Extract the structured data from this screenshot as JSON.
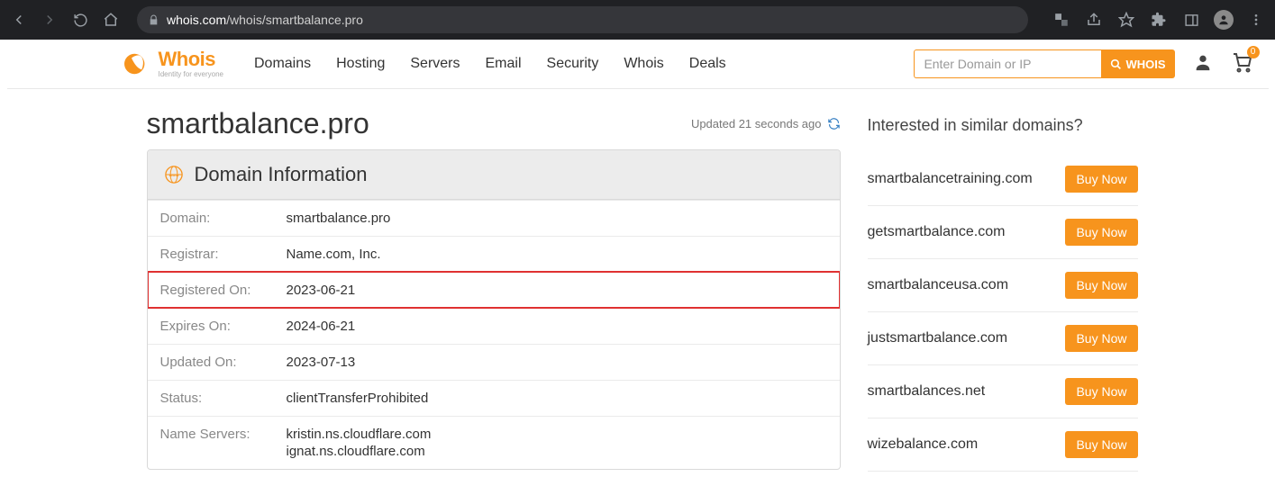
{
  "browser": {
    "url_host": "whois.com",
    "url_path": "/whois/smartbalance.pro"
  },
  "logo": {
    "word": "Whois",
    "tagline": "Identity for everyone"
  },
  "nav": {
    "items": [
      "Domains",
      "Hosting",
      "Servers",
      "Email",
      "Security",
      "Whois",
      "Deals"
    ]
  },
  "search": {
    "placeholder": "Enter Domain or IP",
    "button": "WHOIS"
  },
  "cart": {
    "count": "0"
  },
  "title": "smartbalance.pro",
  "updated_text": "Updated 21 seconds ago",
  "panel_title": "Domain Information",
  "info": {
    "domain": {
      "label": "Domain:",
      "value": "smartbalance.pro"
    },
    "registrar": {
      "label": "Registrar:",
      "value": "Name.com, Inc."
    },
    "registered": {
      "label": "Registered On:",
      "value": "2023-06-21"
    },
    "expires": {
      "label": "Expires On:",
      "value": "2024-06-21"
    },
    "updated": {
      "label": "Updated On:",
      "value": "2023-07-13"
    },
    "status": {
      "label": "Status:",
      "value": "clientTransferProhibited"
    },
    "nameservers": {
      "label": "Name Servers:",
      "value1": "kristin.ns.cloudflare.com",
      "value2": "ignat.ns.cloudflare.com"
    }
  },
  "aside": {
    "title": "Interested in similar domains?",
    "buy_label": "Buy Now",
    "items": [
      "smartbalancetraining.com",
      "getsmartbalance.com",
      "smartbalanceusa.com",
      "justsmartbalance.com",
      "smartbalances.net",
      "wizebalance.com"
    ]
  }
}
